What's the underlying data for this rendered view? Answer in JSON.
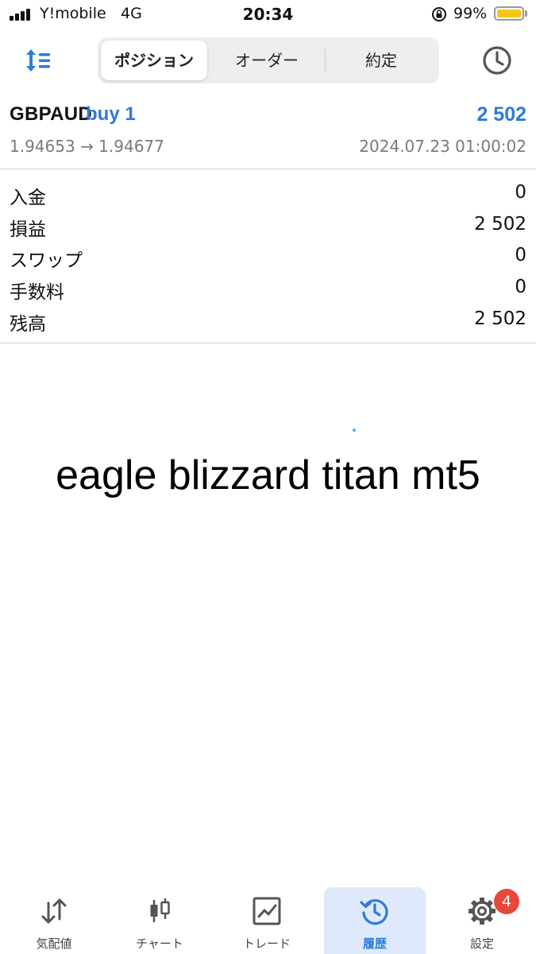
{
  "status_bar": {
    "carrier": "Y!mobile",
    "network": "4G",
    "time": "20:34",
    "battery_percent": "99%",
    "battery_level": 0.99,
    "battery_color": "#f5c518"
  },
  "header": {
    "sort_icon": "sort-icon",
    "tabs": [
      {
        "label": "ポジション",
        "active": true
      },
      {
        "label": "オーダー",
        "active": false
      },
      {
        "label": "約定",
        "active": false
      }
    ],
    "history_icon": "clock-icon"
  },
  "position": {
    "symbol": "GBPAUD",
    "side": "buy 1",
    "profit": "2 502",
    "prices": "1.94653 → 1.94677",
    "datetime": "2024.07.23 01:00:02",
    "accent_color": "#2f7bd9"
  },
  "summary": [
    {
      "label": "入金",
      "value": "0"
    },
    {
      "label": "損益",
      "value": "2 502"
    },
    {
      "label": "スワップ",
      "value": "0"
    },
    {
      "label": "手数料",
      "value": "0"
    },
    {
      "label": "残高",
      "value": "2 502"
    }
  ],
  "overlay_text": "eagle blizzard titan mt5",
  "bottom_nav": [
    {
      "label": "気配値",
      "icon": "quotes-arrows-icon",
      "active": false
    },
    {
      "label": "チャート",
      "icon": "candlestick-icon",
      "active": false
    },
    {
      "label": "トレード",
      "icon": "trade-chart-icon",
      "active": false
    },
    {
      "label": "履歴",
      "icon": "history-icon",
      "active": true
    },
    {
      "label": "設定",
      "icon": "gear-icon",
      "active": false,
      "badge": "4"
    }
  ]
}
